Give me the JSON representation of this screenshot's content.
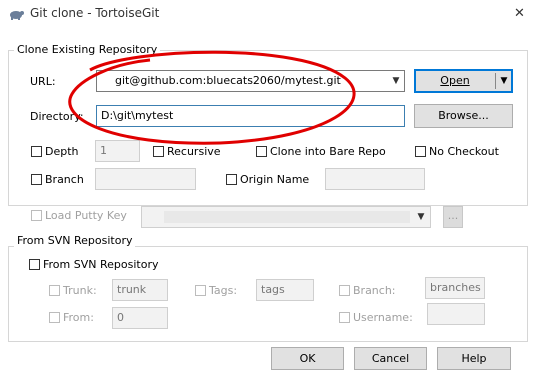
{
  "window": {
    "title": "Git clone - TortoiseGit"
  },
  "clone_group": {
    "label": "Clone Existing Repository",
    "url_label": "URL:",
    "url_value": "git@github.com:bluecats2060/mytest.git",
    "open_label": "Open",
    "directory_label": "Directory:",
    "directory_value": "D:\\git\\mytest",
    "browse_label": "Browse...",
    "depth_label": "Depth",
    "depth_value": "1",
    "recursive_label": "Recursive",
    "bare_label": "Clone into Bare Repo",
    "no_checkout_label": "No Checkout",
    "branch_label": "Branch",
    "origin_label": "Origin Name"
  },
  "putty": {
    "label": "Load Putty Key",
    "browse_label": "..."
  },
  "svn_group": {
    "label": "From SVN Repository",
    "from_svn_label": "From SVN Repository",
    "trunk_label": "Trunk:",
    "trunk_value": "trunk",
    "tags_label": "Tags:",
    "tags_value": "tags",
    "branch_label": "Branch:",
    "branch_value": "branches",
    "from_label": "From:",
    "from_value": "0",
    "username_label": "Username:"
  },
  "buttons": {
    "ok": "OK",
    "cancel": "Cancel",
    "help": "Help"
  },
  "colors": {
    "annotation": "#e00000",
    "focus": "#0078d7"
  }
}
